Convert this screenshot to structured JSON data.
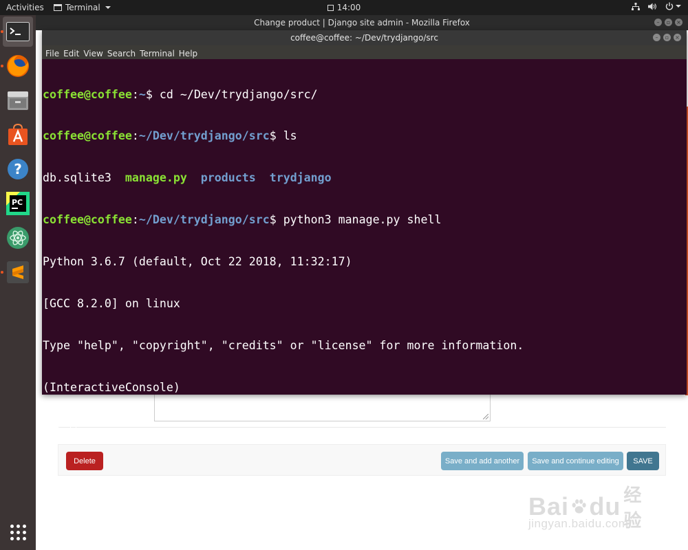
{
  "topbar": {
    "activities": "Activities",
    "app_menu": "Terminal",
    "clock": "14:00"
  },
  "dock": {
    "items": [
      "terminal-icon",
      "firefox-icon",
      "files-icon",
      "software-center-icon",
      "help-icon",
      "pycharm-icon",
      "atom-icon",
      "sublime-text-icon"
    ],
    "show_apps_icon": "app-grid-icon"
  },
  "firefox": {
    "title": "Change product | Django site admin - Mozilla Firefox",
    "buttons": {
      "delete": "Delete",
      "save_add_another": "Save and add another",
      "save_continue": "Save and continue editing",
      "save": "SAVE"
    },
    "colors": {
      "delete": "#ba2121",
      "secondary": "#79aec8",
      "primary": "#417690"
    }
  },
  "terminal": {
    "title": "coffee@coffee: ~/Dev/trydjango/src",
    "menu": [
      "File",
      "Edit",
      "View",
      "Search",
      "Terminal",
      "Help"
    ],
    "prompt_user": "coffee@coffee",
    "lines": {
      "l1": {
        "path": "~",
        "cmd": " cd ~/Dev/trydjango/src/"
      },
      "l2": {
        "path": "~/Dev/trydjango/src",
        "cmd": " ls"
      },
      "ls_output": [
        "db.sqlite3",
        "manage.py",
        "products",
        "trydjango"
      ],
      "l4": {
        "path": "~/Dev/trydjango/src",
        "cmd": " python3 manage.py shell"
      },
      "python_version": "Python 3.6.7 (default, Oct 22 2018, 11:32:17)",
      "gcc": "[GCC 8.2.0] on linux",
      "help": "Type \"help\", \"copyright\", \"credits\" or \"license\" for more information.",
      "console": "(InteractiveConsole)",
      "repl_prompt": ">>> "
    },
    "colors": {
      "background": "#300a24",
      "user": "#8ae234",
      "path": "#729fcf"
    }
  },
  "watermark": {
    "brand": "Bai",
    "brand2": "du",
    "brand_cn": "经验",
    "url": "jingyan.baidu.com"
  }
}
